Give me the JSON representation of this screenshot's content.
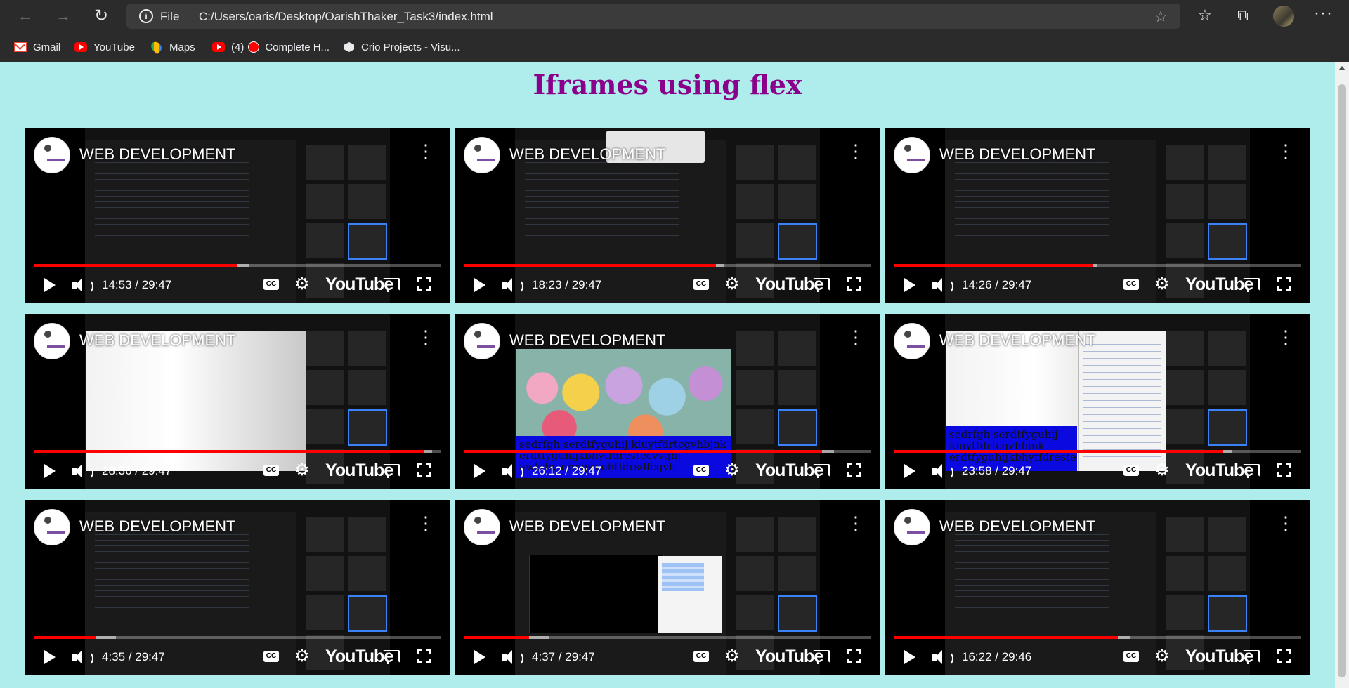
{
  "browser": {
    "address_prefix": "File",
    "url": "C:/Users/oaris/Desktop/OarishThaker_Task3/index.html",
    "bookmarks": [
      {
        "label": "Gmail",
        "icon": "gmail-icon"
      },
      {
        "label": "YouTube",
        "icon": "youtube-icon"
      },
      {
        "label": "Maps",
        "icon": "maps-icon"
      },
      {
        "label": "(4)",
        "icon": "youtube-icon"
      },
      {
        "label": "Complete H...",
        "icon": "red-record-icon"
      },
      {
        "label": "Crio Projects - Visu...",
        "icon": "crio-icon"
      }
    ]
  },
  "page": {
    "title": "Iframes using flex",
    "background": "#afeded",
    "title_color": "#8b008b"
  },
  "videos": [
    {
      "title": "WEB DEVELOPMENT",
      "time": "14:53 / 29:47",
      "played": 0.5,
      "buffered": 0.53
    },
    {
      "title": "WEB DEVELOPMENT",
      "time": "18:23 / 29:47",
      "played": 0.62,
      "buffered": 0.64
    },
    {
      "title": "WEB DEVELOPMENT",
      "time": "14:26 / 29:47",
      "played": 0.49,
      "buffered": 0.5
    },
    {
      "title": "WEB DEVELOPMENT",
      "time": "28:36 / 29:47",
      "played": 0.96,
      "buffered": 0.98
    },
    {
      "title": "WEB DEVELOPMENT",
      "time": "26:12 / 29:47",
      "played": 0.88,
      "buffered": 0.91
    },
    {
      "title": "WEB DEVELOPMENT",
      "time": "23:58 / 29:47",
      "played": 0.81,
      "buffered": 0.83
    },
    {
      "title": "WEB DEVELOPMENT",
      "time": "4:35 / 29:47",
      "played": 0.15,
      "buffered": 0.2
    },
    {
      "title": "WEB DEVELOPMENT",
      "time": "4:37 / 29:47",
      "played": 0.16,
      "buffered": 0.21
    },
    {
      "title": "WEB DEVELOPMENT",
      "time": "16:22 / 29:46",
      "played": 0.55,
      "buffered": 0.58
    }
  ],
  "player": {
    "cc_label": "CC",
    "logo_label": "YouTube",
    "progress_color": "#ff0000"
  },
  "embedded_text": {
    "yarn_text": "sedrfgh serdtfyguhij kiuytfdrtcgvhbjnk erdtfyguhijkbhytfdrestecvvghj awtvbyuinmpoujhtfdrsdfcgvh",
    "blue_text": "sedrfgh serdtfyguhij kiuytfdrtcgvhbjnk erdtfyguhijkbhytfdrestecvvghj"
  }
}
